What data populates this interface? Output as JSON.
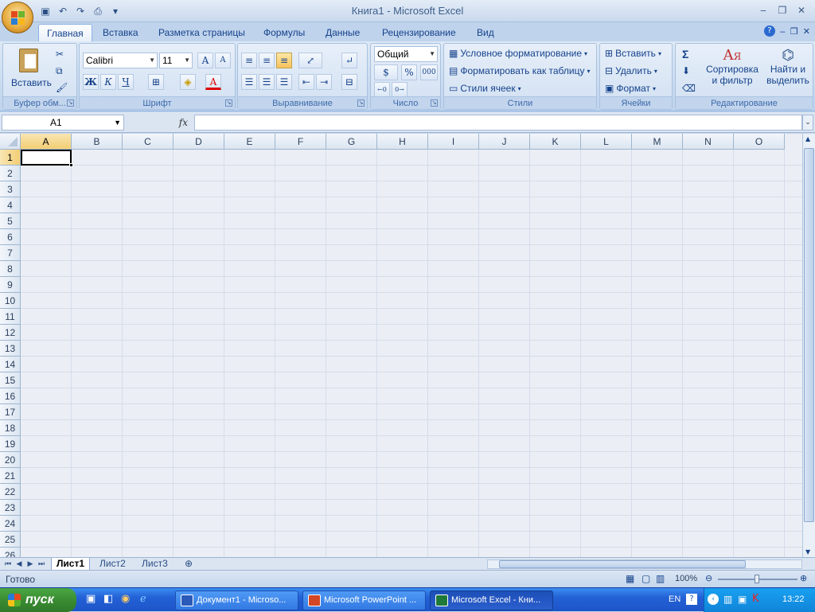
{
  "window": {
    "title": "Книга1  -  Microsoft Excel"
  },
  "tabs": [
    "Главная",
    "Вставка",
    "Разметка страницы",
    "Формулы",
    "Данные",
    "Рецензирование",
    "Вид"
  ],
  "ribbon": {
    "clipboard": {
      "label": "Буфер обм...",
      "paste": "Вставить"
    },
    "font": {
      "label": "Шрифт",
      "name": "Calibri",
      "size": "11",
      "bold": "Ж",
      "italic": "К",
      "underline": "Ч"
    },
    "alignment": {
      "label": "Выравнивание"
    },
    "number": {
      "label": "Число",
      "format": "Общий",
      "percent": "%",
      "thousands": "000"
    },
    "styles": {
      "label": "Стили",
      "conditional": "Условное форматирование",
      "format_table": "Форматировать как таблицу",
      "cell_styles": "Стили ячеек"
    },
    "cells": {
      "label": "Ячейки",
      "insert": "Вставить",
      "delete": "Удалить",
      "format": "Формат"
    },
    "editing": {
      "label": "Редактирование",
      "sort_1": "Сортировка",
      "sort_2": "и фильтр",
      "find_1": "Найти и",
      "find_2": "выделить"
    }
  },
  "formula_bar": {
    "name_box": "A1",
    "fx": "fx",
    "value": ""
  },
  "columns": [
    "A",
    "B",
    "C",
    "D",
    "E",
    "F",
    "G",
    "H",
    "I",
    "J",
    "K",
    "L",
    "M",
    "N",
    "O"
  ],
  "rows": [
    "1",
    "2",
    "3",
    "4",
    "5",
    "6",
    "7",
    "8",
    "9",
    "10",
    "11",
    "12",
    "13",
    "14",
    "15",
    "16",
    "17",
    "18",
    "19",
    "20",
    "21",
    "22",
    "23",
    "24",
    "25",
    "26"
  ],
  "sheets": [
    "Лист1",
    "Лист2",
    "Лист3"
  ],
  "status": {
    "text": "Готово",
    "zoom": "100%"
  },
  "taskbar": {
    "start": "пуск",
    "items": [
      "Документ1 - Microso...",
      "Microsoft PowerPoint ...",
      "Microsoft Excel - Кни..."
    ],
    "lang": "EN",
    "time": "13:22"
  },
  "colors": {
    "accent": "#15428b",
    "taskbar": "#2361d6",
    "start": "#3a8c33"
  }
}
